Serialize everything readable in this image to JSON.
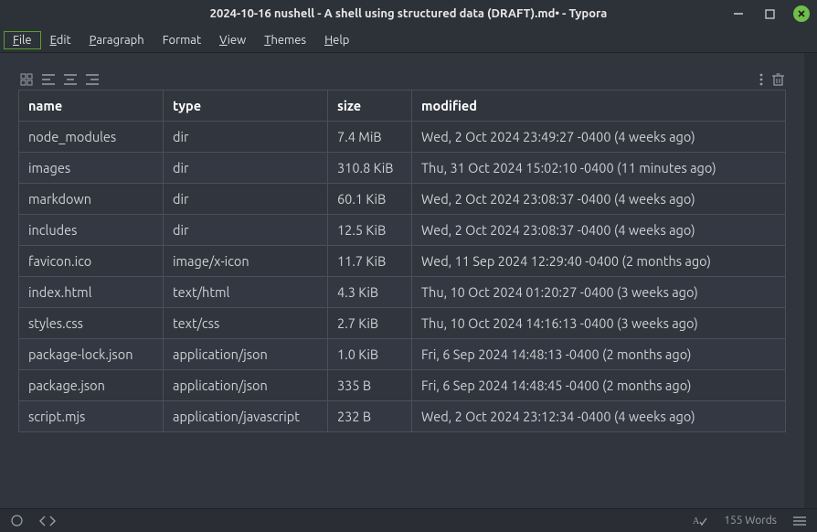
{
  "window": {
    "title": "2024-10-16 nushell - A shell using structured data (DRAFT).md• - Typora"
  },
  "menu": {
    "items": [
      {
        "label": "File",
        "accel": "F",
        "active": true
      },
      {
        "label": "Edit",
        "accel": "E",
        "active": false
      },
      {
        "label": "Paragraph",
        "accel": "P",
        "active": false
      },
      {
        "label": "Format",
        "accel": "",
        "active": false
      },
      {
        "label": "View",
        "accel": "V",
        "active": false
      },
      {
        "label": "Themes",
        "accel": "T",
        "active": false
      },
      {
        "label": "Help",
        "accel": "H",
        "active": false
      }
    ]
  },
  "table": {
    "headers": [
      "name",
      "type",
      "size",
      "modified"
    ],
    "rows": [
      {
        "name": "node_modules",
        "type": "dir",
        "size": "7.4 MiB",
        "modified": "Wed, 2 Oct 2024 23:49:27 -0400 (4 weeks ago)"
      },
      {
        "name": "images",
        "type": "dir",
        "size": "310.8 KiB",
        "modified": "Thu, 31 Oct 2024 15:02:10 -0400 (11 minutes ago)"
      },
      {
        "name": "markdown",
        "type": "dir",
        "size": "60.1 KiB",
        "modified": "Wed, 2 Oct 2024 23:08:37 -0400 (4 weeks ago)"
      },
      {
        "name": "includes",
        "type": "dir",
        "size": "12.5 KiB",
        "modified": "Wed, 2 Oct 2024 23:08:37 -0400 (4 weeks ago)"
      },
      {
        "name": "favicon.ico",
        "type": "image/x-icon",
        "size": "11.7 KiB",
        "modified": "Wed, 11 Sep 2024 12:29:40 -0400 (2 months ago)"
      },
      {
        "name": "index.html",
        "type": "text/html",
        "size": "4.3 KiB",
        "modified": "Thu, 10 Oct 2024 01:20:27 -0400 (3 weeks ago)"
      },
      {
        "name": "styles.css",
        "type": "text/css",
        "size": "2.7 KiB",
        "modified": "Thu, 10 Oct 2024 14:16:13 -0400 (3 weeks ago)"
      },
      {
        "name": "package-lock.json",
        "type": "application/json",
        "size": "1.0 KiB",
        "modified": "Fri, 6 Sep 2024 14:48:13 -0400 (2 months ago)"
      },
      {
        "name": "package.json",
        "type": "application/json",
        "size": "335 B",
        "modified": "Fri, 6 Sep 2024 14:48:45 -0400 (2 months ago)"
      },
      {
        "name": "script.mjs",
        "type": "application/javascript",
        "size": "232 B",
        "modified": "Wed, 2 Oct 2024 23:12:34 -0400 (4 weeks ago)"
      }
    ]
  },
  "status": {
    "words": "155 Words"
  }
}
